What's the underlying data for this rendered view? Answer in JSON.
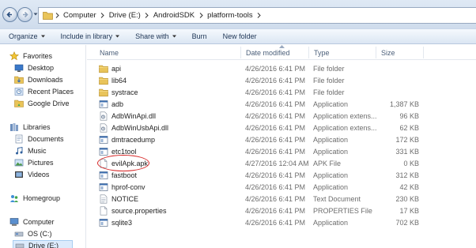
{
  "address_bar": {
    "crumbs": [
      "Computer",
      "Drive (E:)",
      "AndroidSDK",
      "platform-tools"
    ]
  },
  "toolbar": {
    "organize": "Organize",
    "include_in_library": "Include in library",
    "share_with": "Share with",
    "burn": "Burn",
    "new_folder": "New folder"
  },
  "nav": {
    "favorites": "Favorites",
    "desktop": "Desktop",
    "downloads": "Downloads",
    "recent_places": "Recent Places",
    "google_drive": "Google Drive",
    "libraries": "Libraries",
    "documents": "Documents",
    "music": "Music",
    "pictures": "Pictures",
    "videos": "Videos",
    "homegroup": "Homegroup",
    "computer": "Computer",
    "os_c": "OS (C:)",
    "drive_e": "Drive (E:)"
  },
  "columns": {
    "name": "Name",
    "date_modified": "Date modified",
    "type": "Type",
    "size": "Size"
  },
  "files": [
    {
      "name": "api",
      "date": "4/26/2016 6:41 PM",
      "type": "File folder",
      "size": "",
      "icon": "folder-icon"
    },
    {
      "name": "lib64",
      "date": "4/26/2016 6:41 PM",
      "type": "File folder",
      "size": "",
      "icon": "folder-icon"
    },
    {
      "name": "systrace",
      "date": "4/26/2016 6:41 PM",
      "type": "File folder",
      "size": "",
      "icon": "folder-icon"
    },
    {
      "name": "adb",
      "date": "4/26/2016 6:41 PM",
      "type": "Application",
      "size": "1,387 KB",
      "icon": "application-icon"
    },
    {
      "name": "AdbWinApi.dll",
      "date": "4/26/2016 6:41 PM",
      "type": "Application extens...",
      "size": "96 KB",
      "icon": "dll-icon"
    },
    {
      "name": "AdbWinUsbApi.dll",
      "date": "4/26/2016 6:41 PM",
      "type": "Application extens...",
      "size": "62 KB",
      "icon": "dll-icon"
    },
    {
      "name": "dmtracedump",
      "date": "4/26/2016 6:41 PM",
      "type": "Application",
      "size": "172 KB",
      "icon": "application-icon"
    },
    {
      "name": "etc1tool",
      "date": "4/26/2016 6:41 PM",
      "type": "Application",
      "size": "331 KB",
      "icon": "application-icon"
    },
    {
      "name": "evilApk.apk",
      "date": "4/27/2016 12:04 AM",
      "type": "APK File",
      "size": "0 KB",
      "icon": "blank-file-icon"
    },
    {
      "name": "fastboot",
      "date": "4/26/2016 6:41 PM",
      "type": "Application",
      "size": "312 KB",
      "icon": "application-icon"
    },
    {
      "name": "hprof-conv",
      "date": "4/26/2016 6:41 PM",
      "type": "Application",
      "size": "42 KB",
      "icon": "application-icon"
    },
    {
      "name": "NOTICE",
      "date": "4/26/2016 6:41 PM",
      "type": "Text Document",
      "size": "230 KB",
      "icon": "text-file-icon"
    },
    {
      "name": "source.properties",
      "date": "4/26/2016 6:41 PM",
      "type": "PROPERTIES File",
      "size": "17 KB",
      "icon": "blank-file-icon"
    },
    {
      "name": "sqlite3",
      "date": "4/26/2016 6:41 PM",
      "type": "Application",
      "size": "702 KB",
      "icon": "application-icon"
    }
  ],
  "annotation_color": "#d62525"
}
